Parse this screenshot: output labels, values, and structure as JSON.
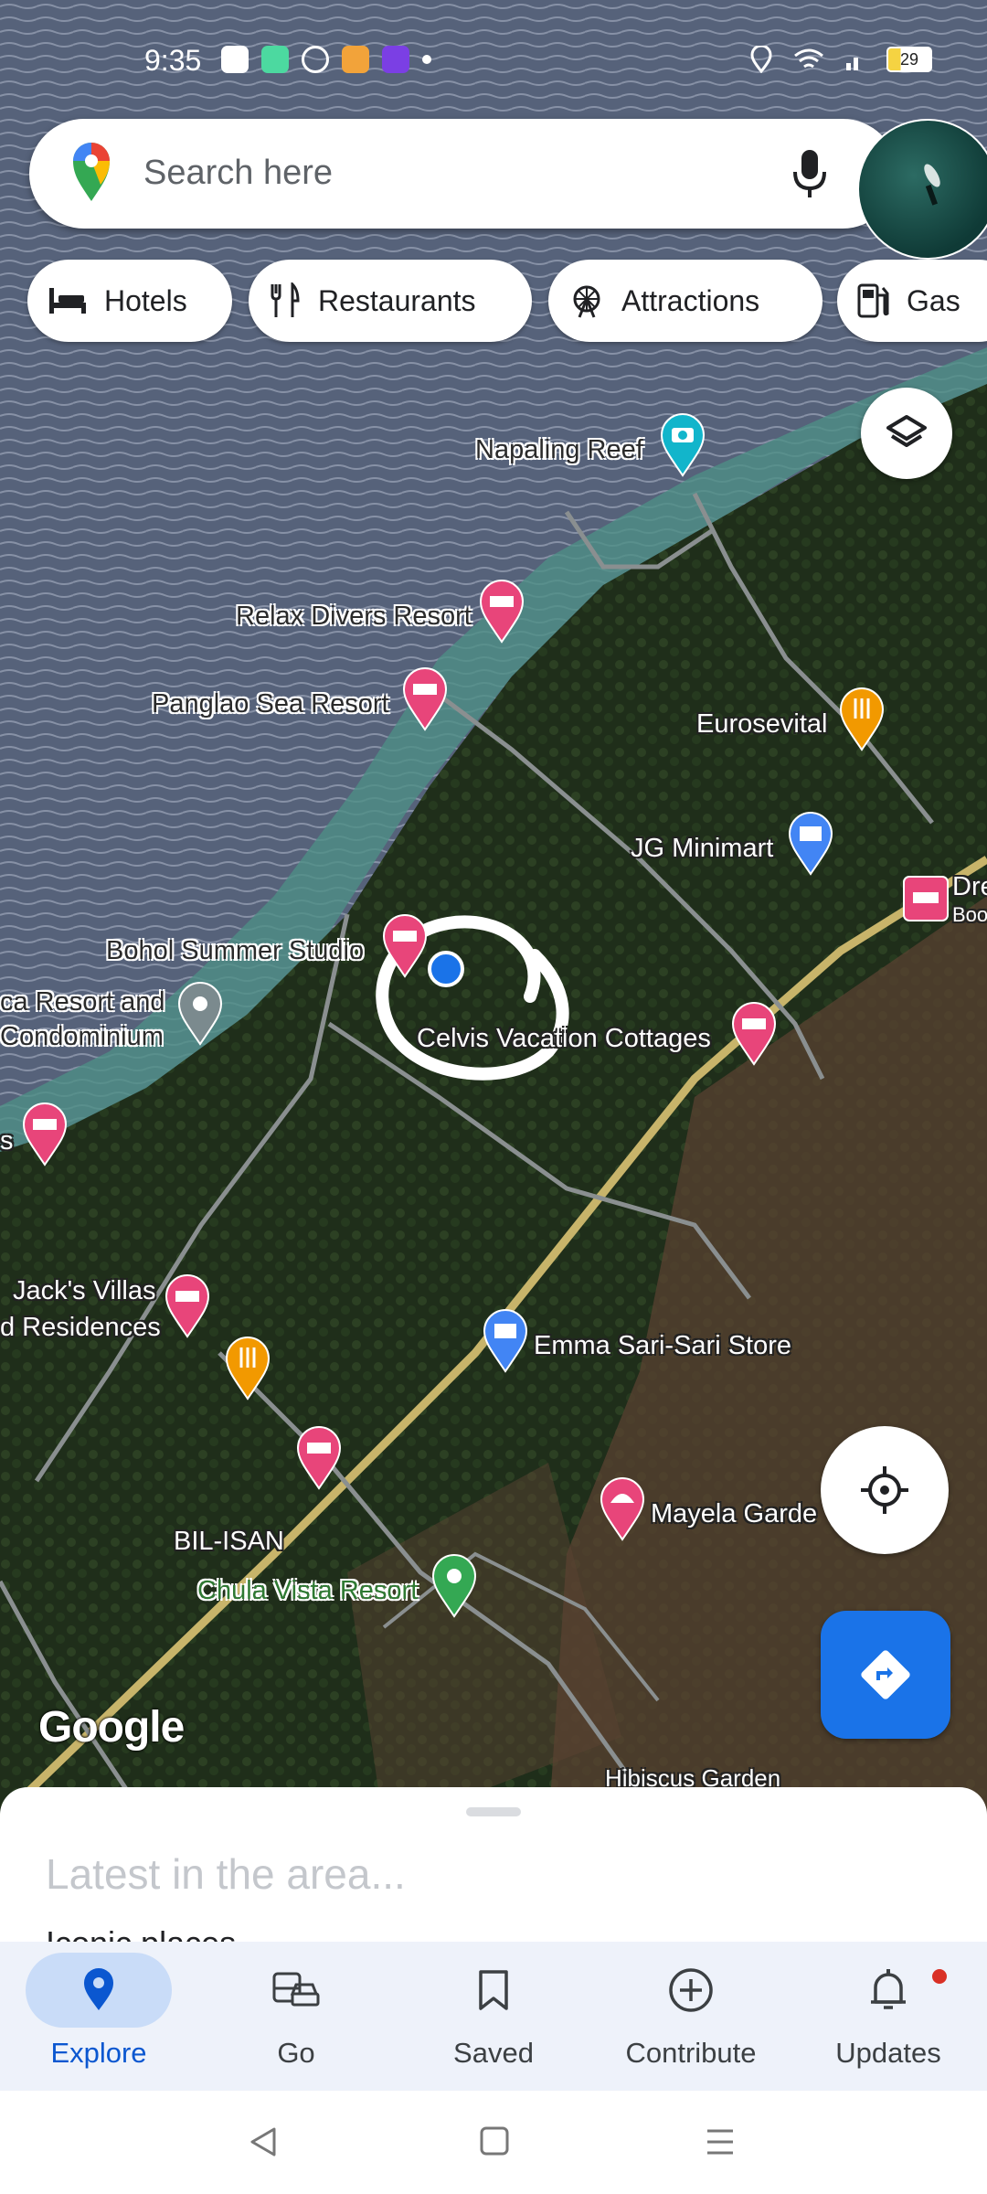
{
  "status_bar": {
    "time": "9:35",
    "battery": "29",
    "notification_icons": [
      "youtube-icon",
      "chat-icon",
      "google-icon",
      "photos-icon",
      "app-icon"
    ]
  },
  "search": {
    "placeholder": "Search here"
  },
  "chips": [
    {
      "label": "Hotels",
      "icon": "bed-icon"
    },
    {
      "label": "Restaurants",
      "icon": "fork-knife-icon"
    },
    {
      "label": "Attractions",
      "icon": "ferris-wheel-icon"
    },
    {
      "label": "Gas",
      "icon": "gas-pump-icon"
    }
  ],
  "map": {
    "labels": {
      "napaling_reef": "Napaling Reef",
      "relax_divers": "Relax Divers Resort",
      "panglao_sea": "Panglao Sea Resort",
      "eurosevital": "Eurosevital",
      "jg_minimart": "JG Minimart",
      "dre": "Dre",
      "boo": "Boo",
      "bohol_summer": "Bohol Summer Studio",
      "ca_resort_1": "ca Resort and",
      "ca_resort_2": "Condominium",
      "celvis": "Celvis Vacation Cottages",
      "s_edge": "s",
      "jacks_1": "Jack's Villas",
      "jacks_2": "d Residences",
      "emma": "Emma Sari-Sari Store",
      "mayela": "Mayela Garde",
      "bilisan": "BIL-ISAN",
      "chula": "Chula Vista Resort",
      "hibiscus": "Hibiscus Garden"
    },
    "google_logo": "Google"
  },
  "sheet": {
    "headline": "Latest in the area...",
    "subhead": "Iconic places"
  },
  "nav": [
    {
      "label": "Explore",
      "icon": "location-pin-icon",
      "active": true
    },
    {
      "label": "Go",
      "icon": "commute-icon"
    },
    {
      "label": "Saved",
      "icon": "bookmark-icon"
    },
    {
      "label": "Contribute",
      "icon": "add-circle-icon"
    },
    {
      "label": "Updates",
      "icon": "bell-icon",
      "badge": true
    }
  ],
  "colors": {
    "accent": "#1a73e8",
    "hotel_pin": "#e8457a",
    "restaurant_pin": "#f29900",
    "shop_pin": "#4285f4",
    "attraction_pin": "#12b5cb",
    "park_pin": "#34a853"
  }
}
